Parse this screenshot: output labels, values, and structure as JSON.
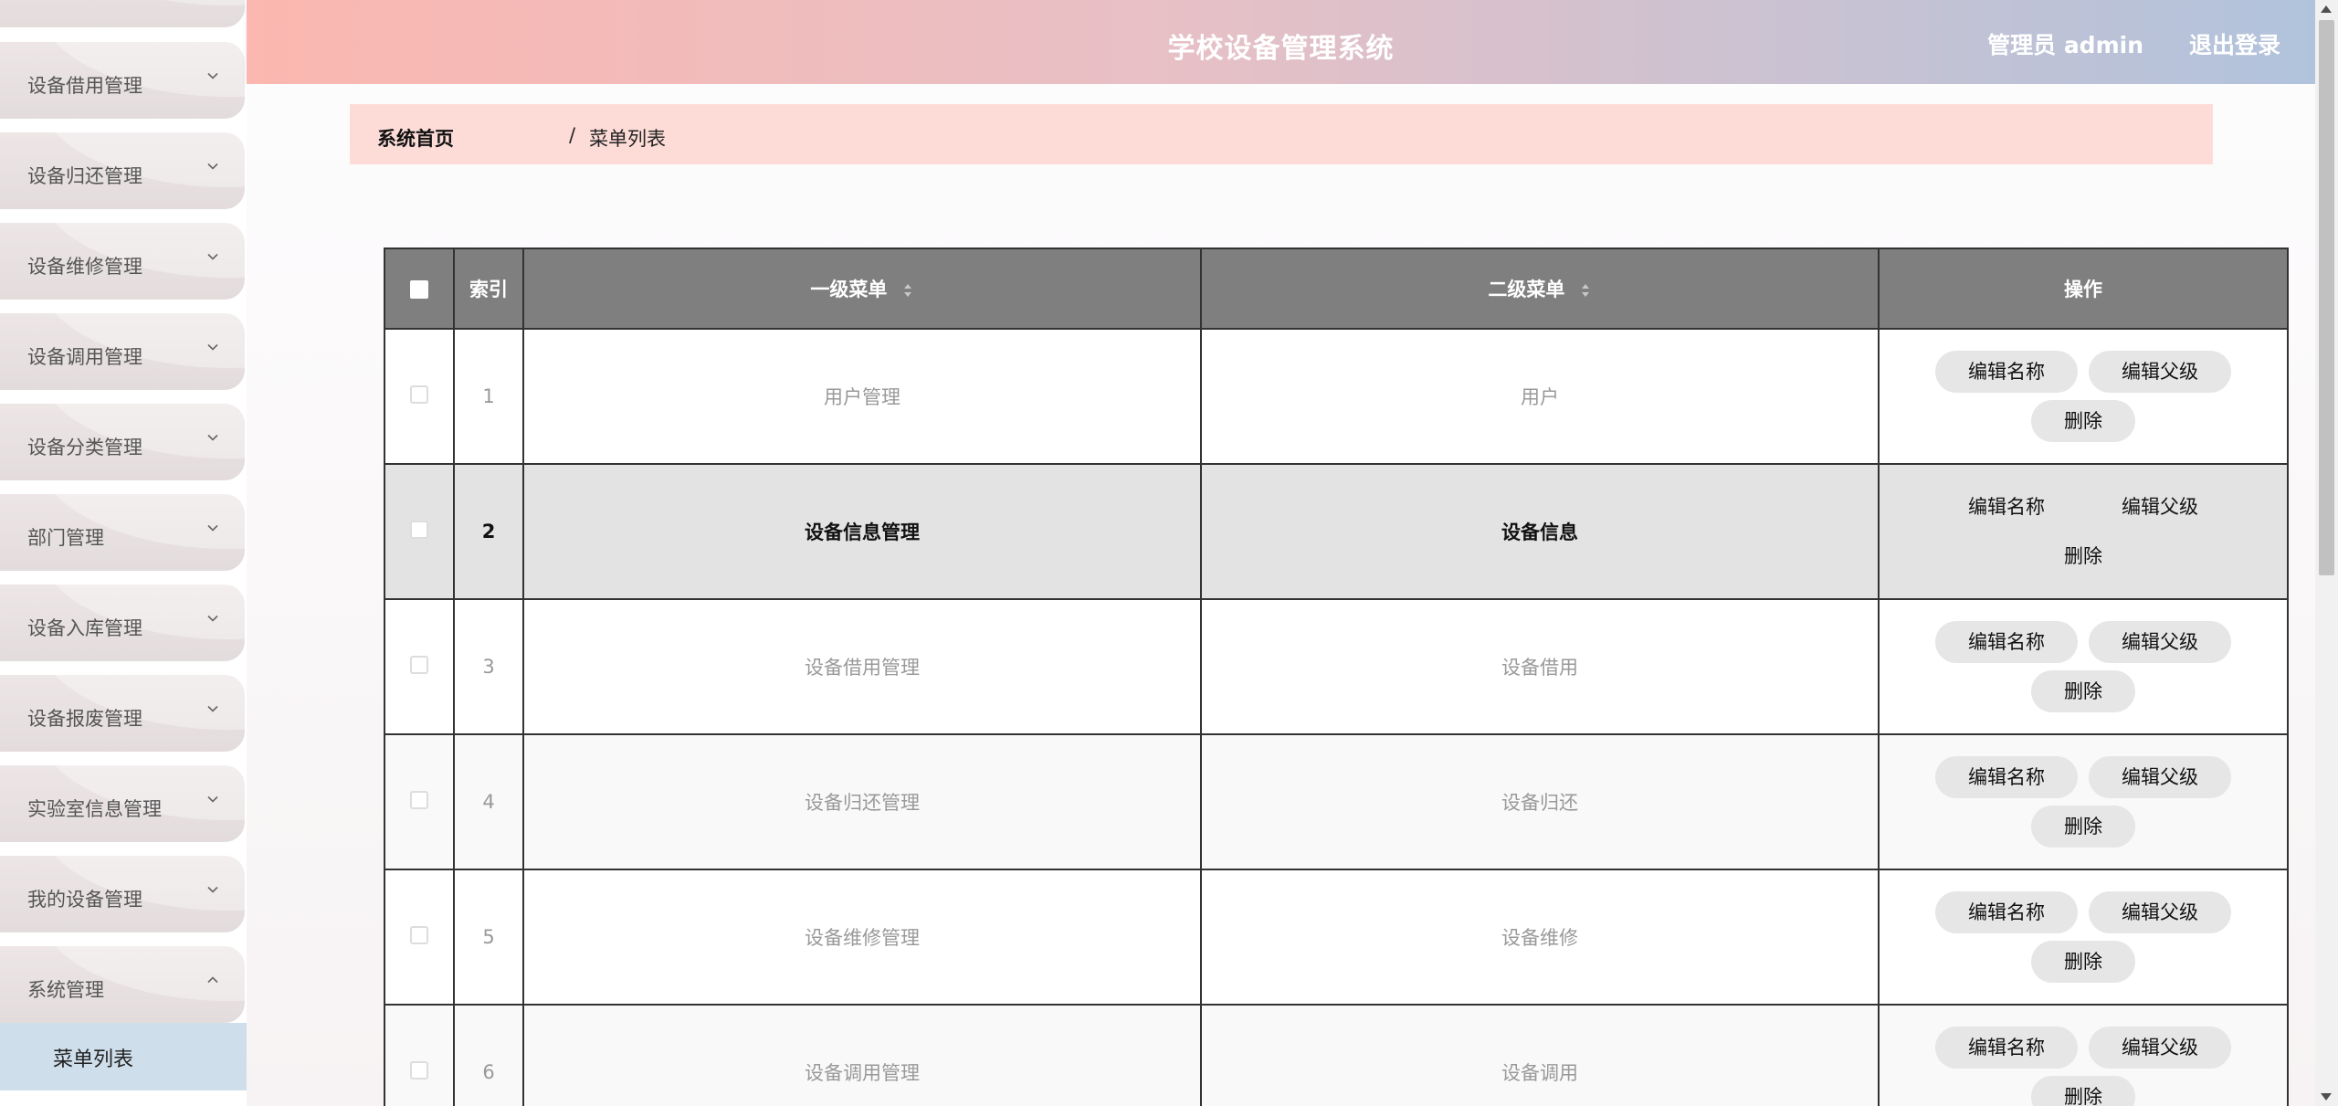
{
  "header": {
    "title": "学校设备管理系统",
    "user": "管理员 admin",
    "logout": "退出登录"
  },
  "sidebar": {
    "items": [
      {
        "label": "设备借用管理"
      },
      {
        "label": "设备归还管理"
      },
      {
        "label": "设备维修管理"
      },
      {
        "label": "设备调用管理"
      },
      {
        "label": "设备分类管理"
      },
      {
        "label": "部门管理"
      },
      {
        "label": "设备入库管理"
      },
      {
        "label": "设备报废管理"
      },
      {
        "label": "实验室信息管理"
      },
      {
        "label": "我的设备管理"
      },
      {
        "label": "系统管理"
      }
    ],
    "sub_item": "菜单列表"
  },
  "breadcrumb": {
    "home": "系统首页",
    "separator": "/",
    "current": "菜单列表"
  },
  "table": {
    "columns": {
      "index": "索引",
      "level1": "一级菜单",
      "level2": "二级菜单",
      "actions": "操作"
    },
    "rows": [
      {
        "index": "1",
        "level1": "用户管理",
        "level2": "用户"
      },
      {
        "index": "2",
        "level1": "设备信息管理",
        "level2": "设备信息"
      },
      {
        "index": "3",
        "level1": "设备借用管理",
        "level2": "设备借用"
      },
      {
        "index": "4",
        "level1": "设备归还管理",
        "level2": "设备归还"
      },
      {
        "index": "5",
        "level1": "设备维修管理",
        "level2": "设备维修"
      },
      {
        "index": "6",
        "level1": "设备调用管理",
        "level2": "设备调用"
      }
    ],
    "buttons": {
      "edit_name": "编辑名称",
      "edit_parent": "编辑父级",
      "delete": "删除"
    }
  }
}
